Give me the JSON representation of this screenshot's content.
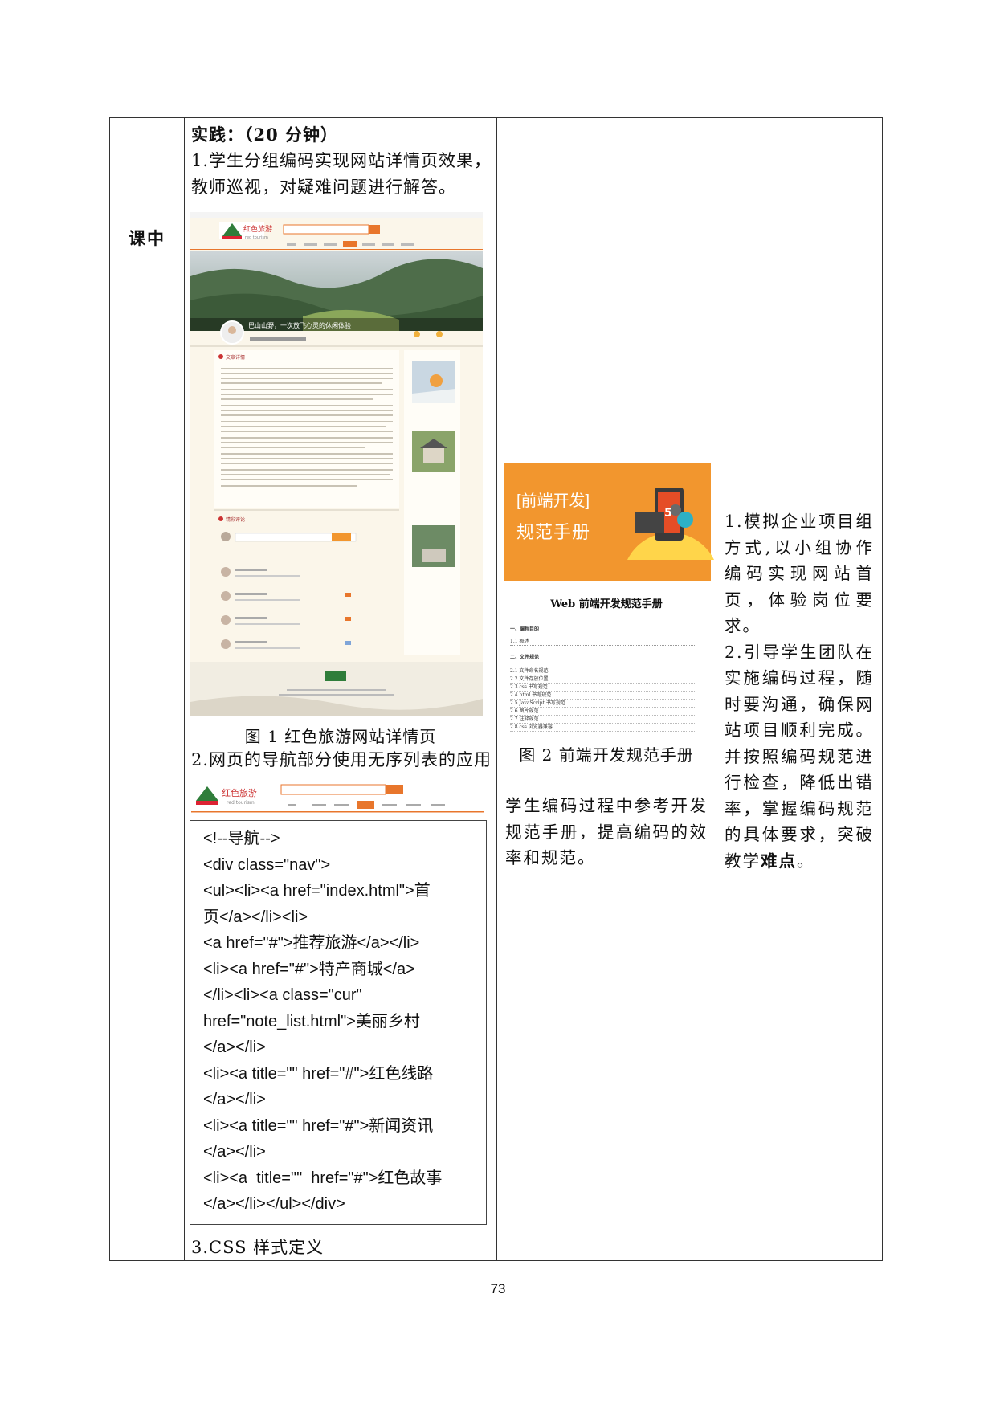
{
  "phase_label": "课中",
  "practice": {
    "heading": "实践：（20 分钟）",
    "step1": "1.学生分组编码实现网站详情页效果，教师巡视，对疑难问题进行解答。",
    "site": {
      "logo_cn": "红色旅游",
      "logo_en": "red tourism",
      "hero_caption": "巴山山野，一次放飞心灵的休闲体验",
      "section_article": "文章详情",
      "section_comment": "精彩评论"
    },
    "figure1_caption": "图 1 红色旅游网站详情页",
    "step2": "2.网页的导航部分使用无序列表的应用",
    "code_lines": [
      "<!--导航-->",
      "<div class=\"nav\">",
      "<ul><li><a href=\"index.html\">首",
      "页</a></li><li>",
      "<a href=\"#\">推荐旅游</a></li>",
      "<li><a href=\"#\">特产商城</a>",
      "</li><li><a class=\"cur\"",
      "href=\"note_list.html\">美丽乡村",
      "</a></li>",
      "<li><a title=\"\" href=\"#\">红色线路",
      "</a></li>",
      "<li><a title=\"\" href=\"#\">新闻资讯",
      "</a></li>",
      "<li><a  title=\"\"  href=\"#\">红色故事",
      "</a></li></ul></div>"
    ],
    "step3": "3.CSS 样式定义"
  },
  "resources": {
    "banner_tag": "[前端开发]",
    "banner_title": "规范手册",
    "doc_title": "Web 前端开发规范手册",
    "doc_section1": "一、编程目的",
    "doc_item1": "1.1  概述",
    "doc_section2": "二、文件规范",
    "doc_items": [
      "2.1 文件命名规范",
      "2.2 文件存放位置",
      "2.3 css 书写规范",
      "2.4 html 书写规范",
      "2.5 JavaScript 书写规范",
      "2.6 图片规范",
      "2.7 注释规范",
      "2.8 css 浏览器兼容"
    ],
    "figure2_caption": "图 2  前端开发规范手册",
    "note": "学生编码过程中参考开发规范手册，提高编码的效率和规范。"
  },
  "intent": {
    "p1": "1.模拟企业项目组方式,以小组协作编码实现网站首页，体验岗位要求。",
    "p2_pre": "2.引导学生团队在实施编码过程，随时要沟通，确保网站项目顺利完成。并按照编码规范进行检查，降低出错率，掌握编码规范的具体要求，突破教学",
    "p2_bold": "难点",
    "p2_post": "。"
  },
  "page_number": "73",
  "colors": {
    "accent_orange": "#f2962e",
    "site_orange": "#e8762c",
    "border": "#333333"
  }
}
